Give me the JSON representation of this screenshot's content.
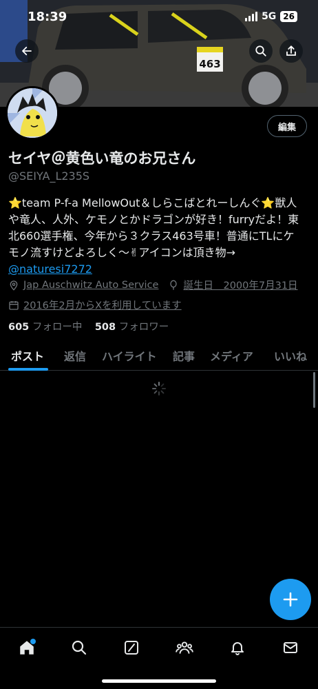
{
  "status_bar": {
    "time": "18:39",
    "network": "5G",
    "battery": "26"
  },
  "banner": {
    "number_plate": "463"
  },
  "profile": {
    "edit_label": "編集",
    "name": "セイヤ＠黄色い竜のお兄さん",
    "handle": "@SEIYA_L235S",
    "bio_line1": "⭐team P-f-a MellowOut＆しらこばとれーしんぐ⭐獣人",
    "bio_line2": "や竜人、人外、ケモノとかドラゴンが好き！furryだよ！東",
    "bio_line3": "北660選手権、今年から３クラス463号車！普通にTLにケ",
    "bio_line4": "モノ流すけどよろしく〜✌アイコンは頂き物→",
    "bio_link": "@naturesi7272",
    "location": "Jap Auschwitz Auto Service",
    "birthday": "誕生日　2000年7月31日",
    "joined": "2016年2月からXを利用しています",
    "following_count": "605",
    "following_label": "フォロー中",
    "followers_count": "508",
    "followers_label": "フォロワー"
  },
  "tabs": [
    {
      "label": "ポスト",
      "active": true
    },
    {
      "label": "返信"
    },
    {
      "label": "ハイライト"
    },
    {
      "label": "記事"
    },
    {
      "label": "メディア"
    },
    {
      "label": "いいね"
    }
  ],
  "icons": {
    "banner": [
      "back-icon",
      "search-icon",
      "share-icon"
    ],
    "meta": [
      "location-icon",
      "balloon-icon",
      "calendar-icon"
    ],
    "fab": "plus-icon",
    "bottom_nav": [
      "home-icon",
      "search-icon",
      "grok-icon",
      "communities-icon",
      "notifications-icon",
      "messages-icon"
    ]
  },
  "colors": {
    "accent": "#1d9bf0",
    "background": "#000000",
    "secondary_text": "#71767b",
    "primary_text": "#e7e9ea"
  }
}
